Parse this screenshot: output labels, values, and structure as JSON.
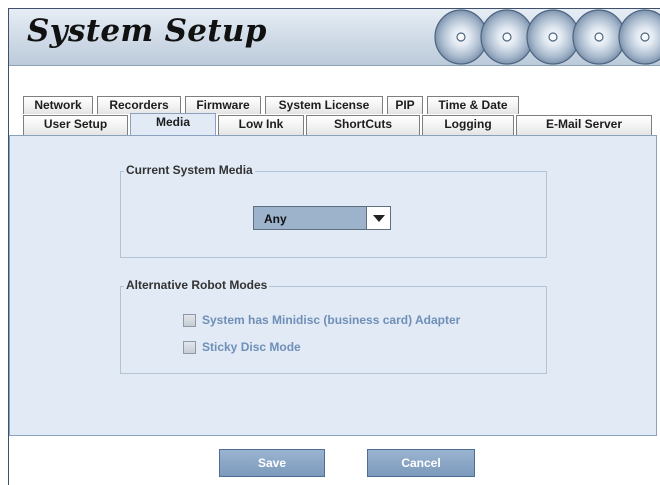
{
  "app": {
    "title": "System Setup"
  },
  "tabs": {
    "row1": [
      "Network",
      "Recorders",
      "Firmware",
      "System License",
      "PIP",
      "Time & Date"
    ],
    "row2": [
      "User Setup",
      "Media",
      "Low Ink",
      "ShortCuts",
      "Logging",
      "E-Mail Server"
    ],
    "active": "Media"
  },
  "media_group": {
    "title": "Current System Media",
    "select_value": "Any"
  },
  "robot_group": {
    "title": "Alternative Robot Modes",
    "options": [
      {
        "label": "System has Minidisc (business card) Adapter",
        "checked": false,
        "enabled": false
      },
      {
        "label": "Sticky Disc Mode",
        "checked": false,
        "enabled": false
      }
    ]
  },
  "buttons": {
    "save": "Save",
    "cancel": "Cancel"
  },
  "colors": {
    "panel_bg": "#e1eaf5",
    "dropdown_bg": "#9db3cc",
    "button_bg": "#8ba6c6",
    "disabled_label": "#6f8fb8"
  },
  "icons": {
    "header_graphic": "disc-stack-icon",
    "dropdown_arrow": "chevron-down-icon"
  }
}
